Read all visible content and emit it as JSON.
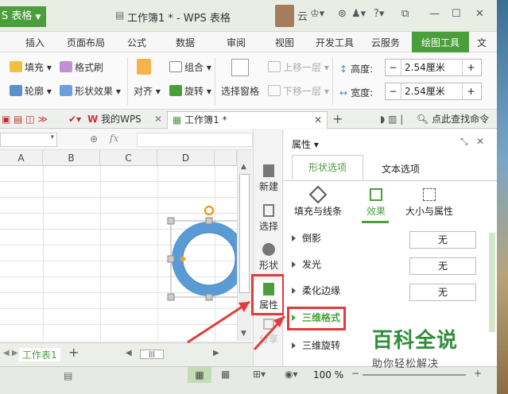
{
  "app": {
    "button_label": "S 表格",
    "title": "工作簿1 * - WPS 表格",
    "user": "云"
  },
  "menu": [
    "插入",
    "页面布局",
    "公式",
    "数据",
    "审阅",
    "视图",
    "开发工具",
    "云服务",
    "绘图工具",
    "文"
  ],
  "ribbon": {
    "fill": "填充",
    "format_painter": "格式刷",
    "outline": "轮廓",
    "shape_effects": "形状效果",
    "align": "对齐",
    "group": "组合",
    "rotate": "旋转",
    "selection_pane": "选择窗格",
    "bring_forward": "上移一层",
    "send_backward": "下移一层",
    "height_label": "高度:",
    "height_value": "2.54厘米",
    "width_label": "宽度:",
    "width_value": "2.54厘米"
  },
  "tabs": {
    "my_wps": "我的WPS",
    "workbook": "工作簿1 *",
    "search": "点此查找命令"
  },
  "formula": {
    "fx": "fx"
  },
  "columns": [
    "A",
    "B",
    "C",
    "D"
  ],
  "sheet": {
    "tab": "工作表1"
  },
  "sidebar": [
    "新建",
    "选择",
    "形状",
    "属性",
    "分享"
  ],
  "panel": {
    "title": "属性",
    "tab_shape": "形状选项",
    "tab_text": "文本选项",
    "sub_fill": "填充与线条",
    "sub_effect": "效果",
    "sub_size": "大小与属性",
    "rows": [
      {
        "label": "倒影",
        "value": "无"
      },
      {
        "label": "发光",
        "value": "无"
      },
      {
        "label": "柔化边缘",
        "value": "无"
      }
    ],
    "three_d_format": "三维格式",
    "three_d_rotate": "三维旋转"
  },
  "status": {
    "zoom": "100 %"
  },
  "watermark": {
    "main": "百科全说",
    "sub": "助你轻松解决"
  },
  "colors": {
    "accent": "#4b9e3c",
    "ring": "#5a9bd5",
    "highlight": "#e23b3b"
  }
}
